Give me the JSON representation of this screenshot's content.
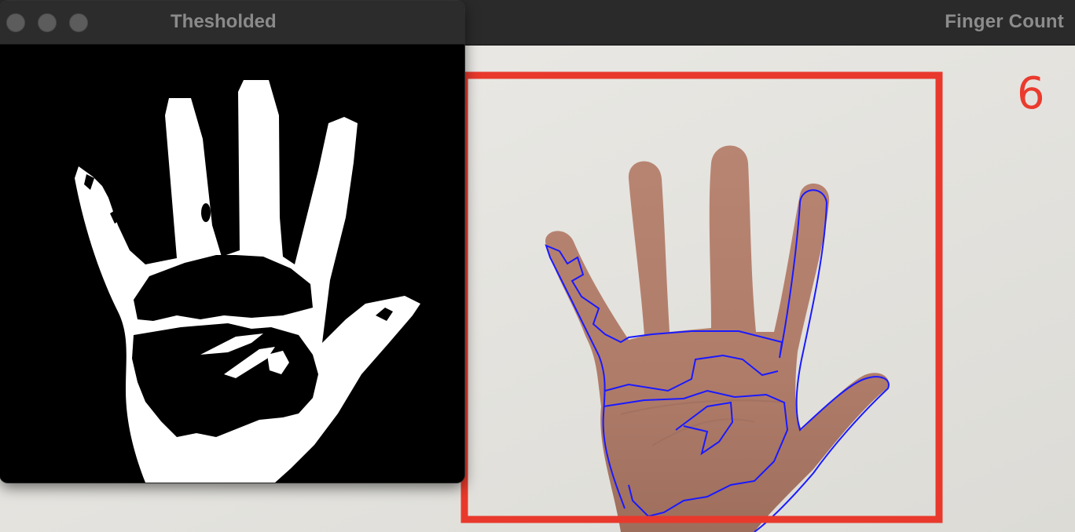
{
  "windows": {
    "main": {
      "title": "Finger Count",
      "finger_count": "6"
    },
    "threshold": {
      "title": "Thesholded"
    }
  },
  "colors": {
    "roi_box": "#e8392c",
    "contour": "#1a1aff",
    "count_text": "#ea3b2e",
    "mask_fg": "#ffffff",
    "mask_bg": "#000000"
  },
  "icons": {
    "close": "traffic-light-close",
    "minimize": "traffic-light-minimize",
    "zoom": "traffic-light-zoom"
  }
}
